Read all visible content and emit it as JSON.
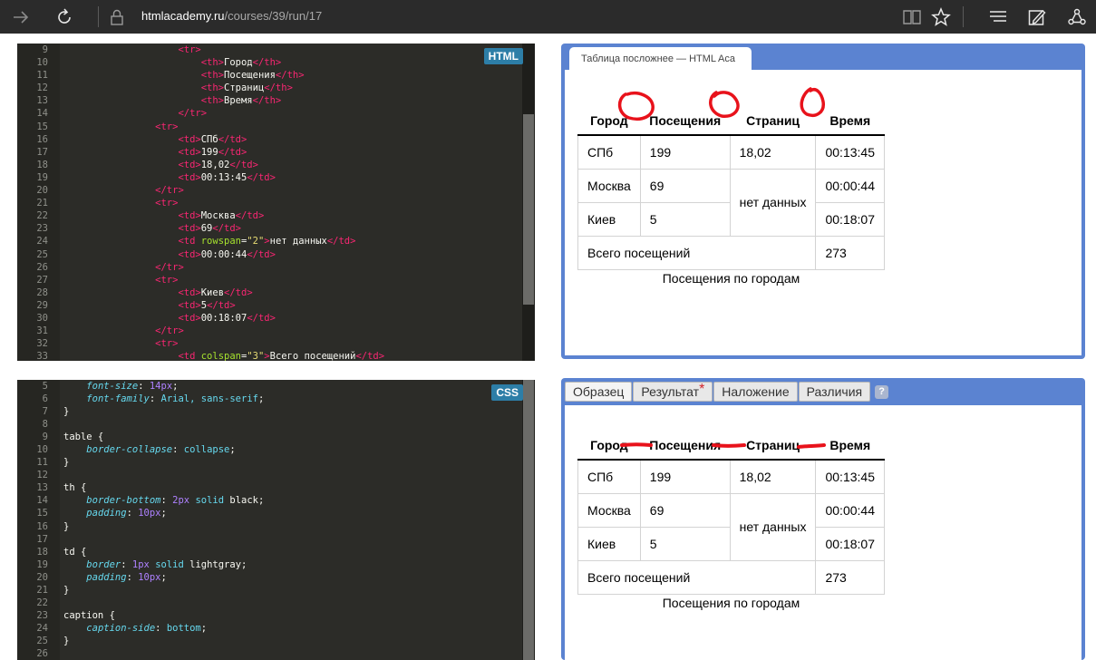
{
  "browser": {
    "host": "htmlacademy.ru",
    "path": "/courses/39/run/17",
    "icons": [
      "forward-icon",
      "refresh-icon",
      "lock-icon",
      "reading-view-icon",
      "favorite-star-icon",
      "hub-icon",
      "web-note-icon",
      "share-icon"
    ]
  },
  "html_editor": {
    "badge": "HTML",
    "lines": [
      {
        "n": "9",
        "parts": [
          {
            "t": "                    ",
            "c": ""
          },
          {
            "t": "<",
            "c": "tg"
          },
          {
            "t": "tr",
            "c": "tg"
          },
          {
            "t": ">",
            "c": "tg"
          }
        ]
      },
      {
        "n": "10",
        "parts": [
          {
            "t": "                        ",
            "c": ""
          },
          {
            "t": "<th>",
            "c": "tg"
          },
          {
            "t": "Город",
            "c": ""
          },
          {
            "t": "</th>",
            "c": "tg"
          }
        ]
      },
      {
        "n": "11",
        "parts": [
          {
            "t": "                        ",
            "c": ""
          },
          {
            "t": "<th>",
            "c": "tg"
          },
          {
            "t": "Посещения",
            "c": ""
          },
          {
            "t": "</th>",
            "c": "tg"
          }
        ]
      },
      {
        "n": "12",
        "parts": [
          {
            "t": "                        ",
            "c": ""
          },
          {
            "t": "<th>",
            "c": "tg"
          },
          {
            "t": "Страниц",
            "c": ""
          },
          {
            "t": "</th>",
            "c": "tg"
          }
        ]
      },
      {
        "n": "13",
        "parts": [
          {
            "t": "                        ",
            "c": ""
          },
          {
            "t": "<th>",
            "c": "tg"
          },
          {
            "t": "Время",
            "c": ""
          },
          {
            "t": "</th>",
            "c": "tg"
          }
        ]
      },
      {
        "n": "14",
        "parts": [
          {
            "t": "                    ",
            "c": ""
          },
          {
            "t": "</tr>",
            "c": "tg"
          }
        ]
      },
      {
        "n": "15",
        "parts": [
          {
            "t": "                ",
            "c": ""
          },
          {
            "t": "<tr>",
            "c": "tg"
          }
        ]
      },
      {
        "n": "16",
        "parts": [
          {
            "t": "                    ",
            "c": ""
          },
          {
            "t": "<td>",
            "c": "tg"
          },
          {
            "t": "СПб",
            "c": ""
          },
          {
            "t": "</td>",
            "c": "tg"
          }
        ]
      },
      {
        "n": "17",
        "parts": [
          {
            "t": "                    ",
            "c": ""
          },
          {
            "t": "<td>",
            "c": "tg"
          },
          {
            "t": "199",
            "c": ""
          },
          {
            "t": "</td>",
            "c": "tg"
          }
        ]
      },
      {
        "n": "18",
        "parts": [
          {
            "t": "                    ",
            "c": ""
          },
          {
            "t": "<td>",
            "c": "tg"
          },
          {
            "t": "18,02",
            "c": ""
          },
          {
            "t": "</td>",
            "c": "tg"
          }
        ]
      },
      {
        "n": "19",
        "parts": [
          {
            "t": "                    ",
            "c": ""
          },
          {
            "t": "<td>",
            "c": "tg"
          },
          {
            "t": "00:13:45",
            "c": ""
          },
          {
            "t": "</td>",
            "c": "tg"
          }
        ]
      },
      {
        "n": "20",
        "parts": [
          {
            "t": "                ",
            "c": ""
          },
          {
            "t": "</tr>",
            "c": "tg"
          }
        ]
      },
      {
        "n": "21",
        "parts": [
          {
            "t": "                ",
            "c": ""
          },
          {
            "t": "<tr>",
            "c": "tg"
          }
        ]
      },
      {
        "n": "22",
        "parts": [
          {
            "t": "                    ",
            "c": ""
          },
          {
            "t": "<td>",
            "c": "tg"
          },
          {
            "t": "Москва",
            "c": ""
          },
          {
            "t": "</td>",
            "c": "tg"
          }
        ]
      },
      {
        "n": "23",
        "parts": [
          {
            "t": "                    ",
            "c": ""
          },
          {
            "t": "<td>",
            "c": "tg"
          },
          {
            "t": "69",
            "c": ""
          },
          {
            "t": "</td>",
            "c": "tg"
          }
        ]
      },
      {
        "n": "24",
        "parts": [
          {
            "t": "                    ",
            "c": ""
          },
          {
            "t": "<td ",
            "c": "tg"
          },
          {
            "t": "rowspan",
            "c": "at"
          },
          {
            "t": "=",
            "c": ""
          },
          {
            "t": "\"2\"",
            "c": "st"
          },
          {
            "t": ">",
            "c": "tg"
          },
          {
            "t": "нет данных",
            "c": ""
          },
          {
            "t": "</td>",
            "c": "tg"
          }
        ]
      },
      {
        "n": "25",
        "parts": [
          {
            "t": "                    ",
            "c": ""
          },
          {
            "t": "<td>",
            "c": "tg"
          },
          {
            "t": "00:00:44",
            "c": ""
          },
          {
            "t": "</td>",
            "c": "tg"
          }
        ]
      },
      {
        "n": "26",
        "parts": [
          {
            "t": "                ",
            "c": ""
          },
          {
            "t": "</tr>",
            "c": "tg"
          }
        ]
      },
      {
        "n": "27",
        "parts": [
          {
            "t": "                ",
            "c": ""
          },
          {
            "t": "<tr>",
            "c": "tg"
          }
        ]
      },
      {
        "n": "28",
        "parts": [
          {
            "t": "                    ",
            "c": ""
          },
          {
            "t": "<td>",
            "c": "tg"
          },
          {
            "t": "Киев",
            "c": ""
          },
          {
            "t": "</td>",
            "c": "tg"
          }
        ]
      },
      {
        "n": "29",
        "parts": [
          {
            "t": "                    ",
            "c": ""
          },
          {
            "t": "<td>",
            "c": "tg"
          },
          {
            "t": "5",
            "c": ""
          },
          {
            "t": "</td>",
            "c": "tg"
          }
        ]
      },
      {
        "n": "30",
        "parts": [
          {
            "t": "                    ",
            "c": ""
          },
          {
            "t": "<td>",
            "c": "tg"
          },
          {
            "t": "00:18:07",
            "c": ""
          },
          {
            "t": "</td>",
            "c": "tg"
          }
        ]
      },
      {
        "n": "31",
        "parts": [
          {
            "t": "                ",
            "c": ""
          },
          {
            "t": "</tr>",
            "c": "tg"
          }
        ]
      },
      {
        "n": "32",
        "parts": [
          {
            "t": "                ",
            "c": ""
          },
          {
            "t": "<tr>",
            "c": "tg"
          }
        ]
      },
      {
        "n": "33",
        "parts": [
          {
            "t": "                    ",
            "c": ""
          },
          {
            "t": "<td ",
            "c": "tg"
          },
          {
            "t": "colspan",
            "c": "at"
          },
          {
            "t": "=",
            "c": ""
          },
          {
            "t": "\"3\"",
            "c": "st"
          },
          {
            "t": ">",
            "c": "tg"
          },
          {
            "t": "Всего посещений",
            "c": ""
          },
          {
            "t": "</td>",
            "c": "tg"
          }
        ]
      }
    ]
  },
  "css_editor": {
    "badge": "CSS",
    "lines": [
      {
        "n": "5",
        "parts": [
          {
            "t": "    ",
            "c": ""
          },
          {
            "t": "font-size",
            "c": "pr"
          },
          {
            "t": ": ",
            "c": ""
          },
          {
            "t": "14px",
            "c": "nm"
          },
          {
            "t": ";",
            "c": ""
          }
        ]
      },
      {
        "n": "6",
        "parts": [
          {
            "t": "    ",
            "c": ""
          },
          {
            "t": "font-family",
            "c": "pr"
          },
          {
            "t": ": ",
            "c": ""
          },
          {
            "t": "Arial, sans-serif",
            "c": "kw"
          },
          {
            "t": ";",
            "c": ""
          }
        ]
      },
      {
        "n": "7",
        "parts": [
          {
            "t": "}",
            "c": ""
          }
        ]
      },
      {
        "n": "8",
        "parts": []
      },
      {
        "n": "9",
        "parts": [
          {
            "t": "table {",
            "c": ""
          }
        ]
      },
      {
        "n": "10",
        "parts": [
          {
            "t": "    ",
            "c": ""
          },
          {
            "t": "border-collapse",
            "c": "pr"
          },
          {
            "t": ": ",
            "c": ""
          },
          {
            "t": "collapse",
            "c": "kw"
          },
          {
            "t": ";",
            "c": ""
          }
        ]
      },
      {
        "n": "11",
        "parts": [
          {
            "t": "}",
            "c": ""
          }
        ]
      },
      {
        "n": "12",
        "parts": []
      },
      {
        "n": "13",
        "parts": [
          {
            "t": "th {",
            "c": ""
          }
        ]
      },
      {
        "n": "14",
        "parts": [
          {
            "t": "    ",
            "c": ""
          },
          {
            "t": "border-bottom",
            "c": "pr"
          },
          {
            "t": ": ",
            "c": ""
          },
          {
            "t": "2px",
            "c": "nm"
          },
          {
            "t": " ",
            "c": ""
          },
          {
            "t": "solid",
            "c": "kw"
          },
          {
            "t": " black;",
            "c": ""
          }
        ]
      },
      {
        "n": "15",
        "parts": [
          {
            "t": "    ",
            "c": ""
          },
          {
            "t": "padding",
            "c": "pr"
          },
          {
            "t": ": ",
            "c": ""
          },
          {
            "t": "10px",
            "c": "nm"
          },
          {
            "t": ";",
            "c": ""
          }
        ]
      },
      {
        "n": "16",
        "parts": [
          {
            "t": "}",
            "c": ""
          }
        ]
      },
      {
        "n": "17",
        "parts": []
      },
      {
        "n": "18",
        "parts": [
          {
            "t": "td {",
            "c": ""
          }
        ]
      },
      {
        "n": "19",
        "parts": [
          {
            "t": "    ",
            "c": ""
          },
          {
            "t": "border",
            "c": "pr"
          },
          {
            "t": ": ",
            "c": ""
          },
          {
            "t": "1px",
            "c": "nm"
          },
          {
            "t": " ",
            "c": ""
          },
          {
            "t": "solid",
            "c": "kw"
          },
          {
            "t": " lightgray;",
            "c": ""
          }
        ]
      },
      {
        "n": "20",
        "parts": [
          {
            "t": "    ",
            "c": ""
          },
          {
            "t": "padding",
            "c": "pr"
          },
          {
            "t": ": ",
            "c": ""
          },
          {
            "t": "10px",
            "c": "nm"
          },
          {
            "t": ";",
            "c": ""
          }
        ]
      },
      {
        "n": "21",
        "parts": [
          {
            "t": "}",
            "c": ""
          }
        ]
      },
      {
        "n": "22",
        "parts": []
      },
      {
        "n": "23",
        "parts": [
          {
            "t": "caption {",
            "c": ""
          }
        ]
      },
      {
        "n": "24",
        "parts": [
          {
            "t": "    ",
            "c": ""
          },
          {
            "t": "caption-side",
            "c": "pr"
          },
          {
            "t": ": ",
            "c": ""
          },
          {
            "t": "bottom",
            "c": "kw"
          },
          {
            "t": ";",
            "c": ""
          }
        ]
      },
      {
        "n": "25",
        "parts": [
          {
            "t": "}",
            "c": ""
          }
        ]
      },
      {
        "n": "26",
        "parts": []
      }
    ]
  },
  "preview_top": {
    "tab_title": "Таблица посложнее — HTML Aca"
  },
  "preview_bottom": {
    "tabs": [
      "Образец",
      "Результат",
      "Наложение",
      "Различия"
    ],
    "result_marker": "*",
    "help": "?"
  },
  "table": {
    "headers": [
      "Город",
      "Посещения",
      "Страниц",
      "Время"
    ],
    "row1": [
      "СПб",
      "199",
      "18,02",
      "00:13:45"
    ],
    "row2": [
      "Москва",
      "69",
      "нет данных",
      "00:00:44"
    ],
    "row3": [
      "Киев",
      "5",
      "00:18:07"
    ],
    "total_label": "Всего посещений",
    "total_value": "273",
    "caption": "Посещения по городам"
  },
  "colors": {
    "annotation": "#e8121b",
    "panel_frame": "#5b83d1",
    "editor_bg": "#2c2c28",
    "tag": "#f92672"
  }
}
